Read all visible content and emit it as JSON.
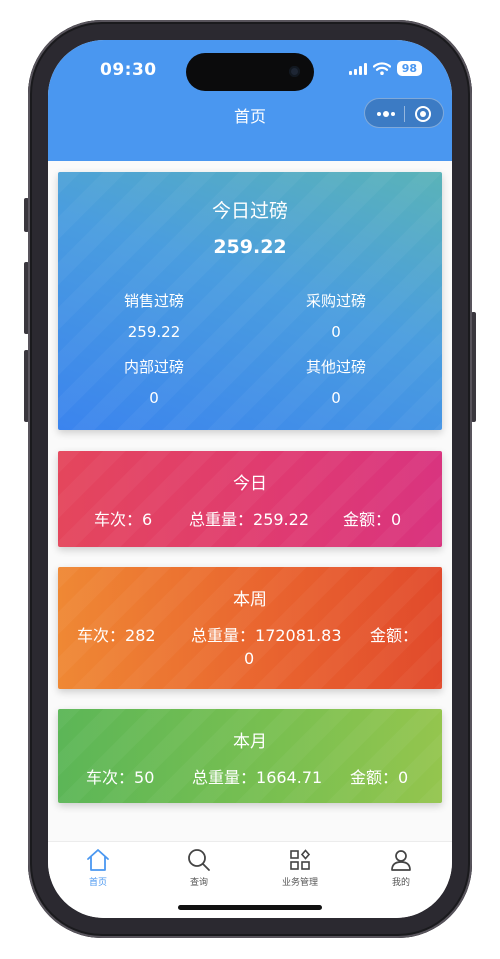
{
  "status_bar": {
    "time": "09:30",
    "battery": "98"
  },
  "header": {
    "title": "首页"
  },
  "today_summary": {
    "title": "今日过磅",
    "total": "259.22",
    "items": [
      {
        "label": "销售过磅",
        "value": "259.22"
      },
      {
        "label": "采购过磅",
        "value": "0"
      },
      {
        "label": "内部过磅",
        "value": "0"
      },
      {
        "label": "其他过磅",
        "value": "0"
      }
    ]
  },
  "stats": {
    "today": {
      "title": "今日",
      "trips_label": "车次：",
      "trips": "6",
      "weight_label": "总重量：",
      "weight": "259.22",
      "amount_label": "金额：",
      "amount": "0"
    },
    "week": {
      "title": "本周",
      "trips_label": "车次：",
      "trips": "282",
      "weight_label": "总重量：",
      "weight": "172081.83",
      "amount_label": "金额：",
      "amount": "0"
    },
    "month": {
      "title": "本月",
      "trips_label": "车次：",
      "trips": "50",
      "weight_label": "总重量：",
      "weight": "1664.71",
      "amount_label": "金额：",
      "amount": "0"
    }
  },
  "tabbar": {
    "items": [
      {
        "label": "首页",
        "icon": "home-icon",
        "active": true
      },
      {
        "label": "查询",
        "icon": "search-icon",
        "active": false
      },
      {
        "label": "业务管理",
        "icon": "grid-icon",
        "active": false
      },
      {
        "label": "我的",
        "icon": "user-icon",
        "active": false
      }
    ]
  },
  "colors": {
    "header": "#4a97f0",
    "today_card": "#4a9ddf",
    "today_stat": "#e0416a",
    "week_stat": "#ea6a30",
    "month_stat": "#7bc050",
    "tab_active": "#4a97f0"
  }
}
